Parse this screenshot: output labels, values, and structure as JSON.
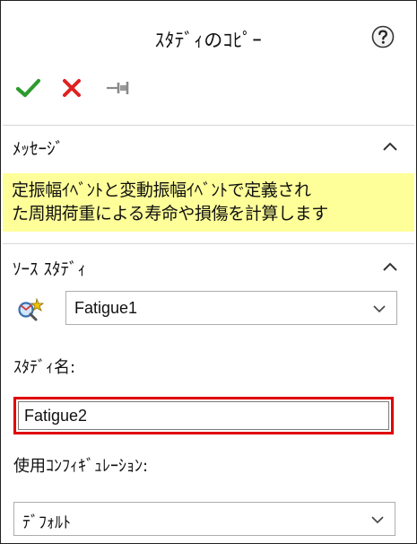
{
  "panel": {
    "title": "ｽﾀﾃﾞｨのｺﾋﾟｰ",
    "help_icon": "question-circle-icon",
    "actions": {
      "ok_icon": "green-check-icon",
      "cancel_icon": "red-x-icon",
      "pin_icon": "pushpin-icon"
    }
  },
  "message_section": {
    "title": "ﾒｯｾｰｼﾞ",
    "text_line1": "定振幅ｲﾍﾞﾝﾄと変動振幅ｲﾍﾞﾝﾄで定義され",
    "text_line2": "た周期荷重による寿命や損傷を計算します",
    "background": "#ffff99"
  },
  "source_section": {
    "title": "ｿｰｽ ｽﾀﾃﾞｨ",
    "source_study_value": "Fatigue1",
    "study_name_label": "ｽﾀﾃﾞｨ名:",
    "study_name_value": "Fatigue2",
    "config_label": "使用ｺﾝﾌｨｷﾞｭﾚｰｼｮﾝ:",
    "config_value": "ﾃﾞﾌｫﾙﾄ",
    "highlight_color": "#e00000"
  }
}
